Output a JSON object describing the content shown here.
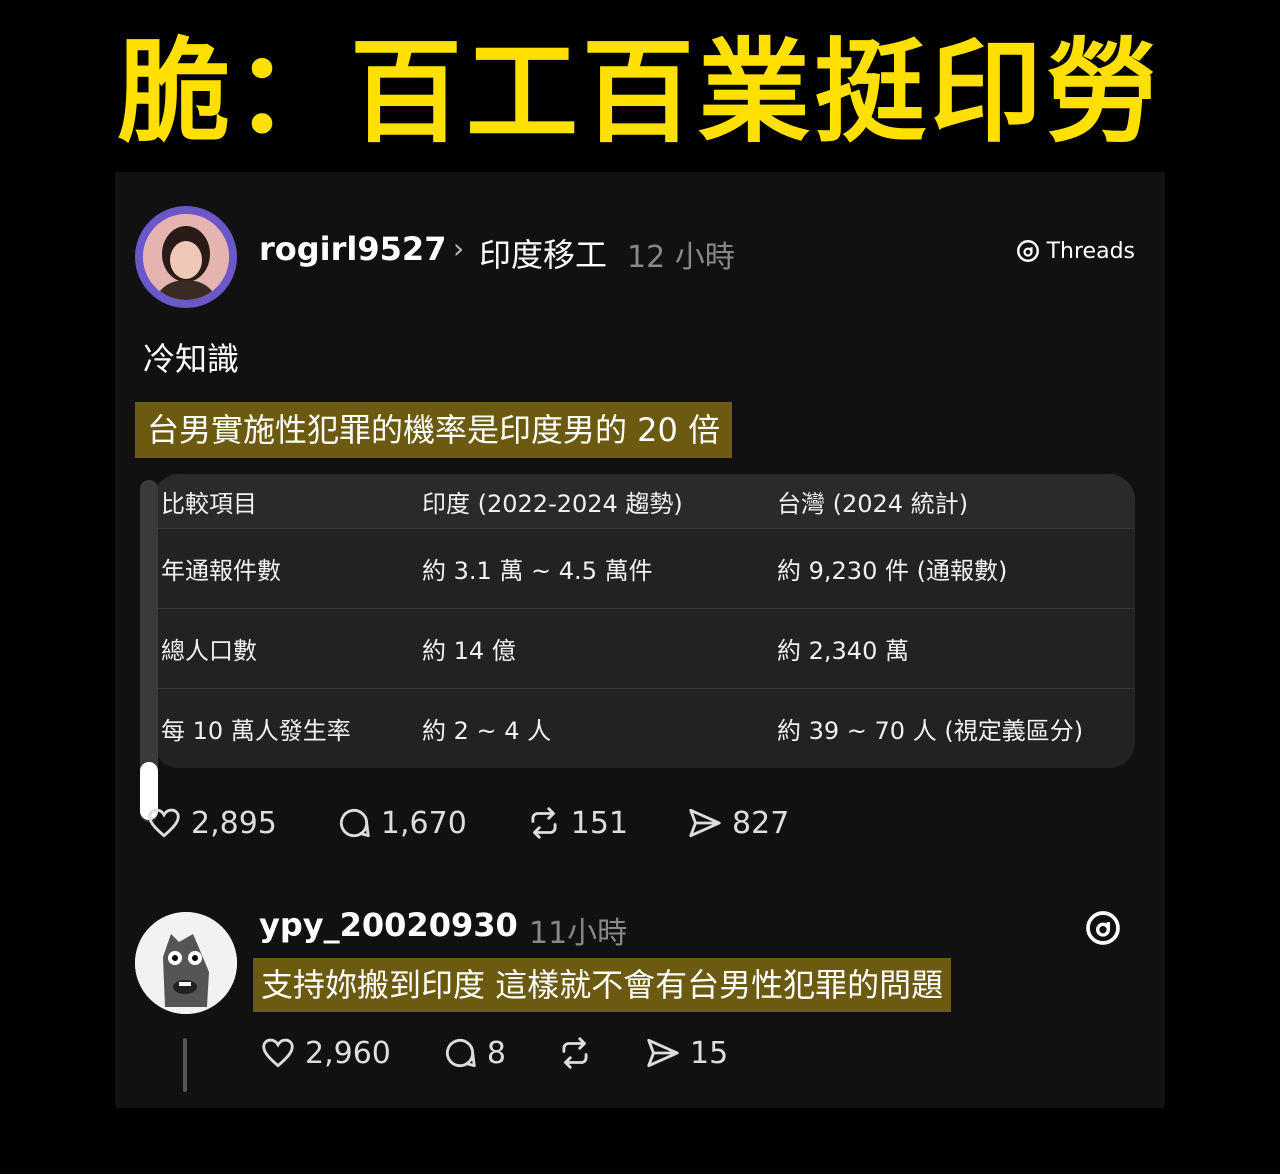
{
  "headline": "脆：百工百業挺印勞",
  "post": {
    "username": "rogirl9527",
    "topic": "印度移工",
    "time": "12 小時",
    "brand": "Threads",
    "text_line1": "冷知識",
    "highlight": "台男實施性犯罪的機率是印度男的 20 倍",
    "table": {
      "headers": [
        "比較項目",
        "印度 (2022-2024 趨勢)",
        "台灣 (2024 統計)"
      ],
      "rows": [
        [
          "年通報件數",
          "約 3.1 萬 ~ 4.5 萬件",
          "約 9,230 件 (通報數)"
        ],
        [
          "總人口數",
          "約 14 億",
          "約 2,340 萬"
        ],
        [
          "每 10 萬人發生率",
          "約 2 ~ 4 人",
          "約 39 ~ 70 人 (視定義區分)"
        ]
      ]
    },
    "stats": {
      "likes": "2,895",
      "replies": "1,670",
      "reposts": "151",
      "shares": "827"
    }
  },
  "reply": {
    "username": "ypy_20020930",
    "time": "11小時",
    "text": "支持妳搬到印度 這樣就不會有台男性犯罪的問題",
    "stats": {
      "likes": "2,960",
      "replies": "8",
      "shares": "15"
    }
  },
  "colors": {
    "headline": "#ffe000",
    "highlight": "#6b5a10",
    "background": "#000000",
    "card": "#111111"
  }
}
